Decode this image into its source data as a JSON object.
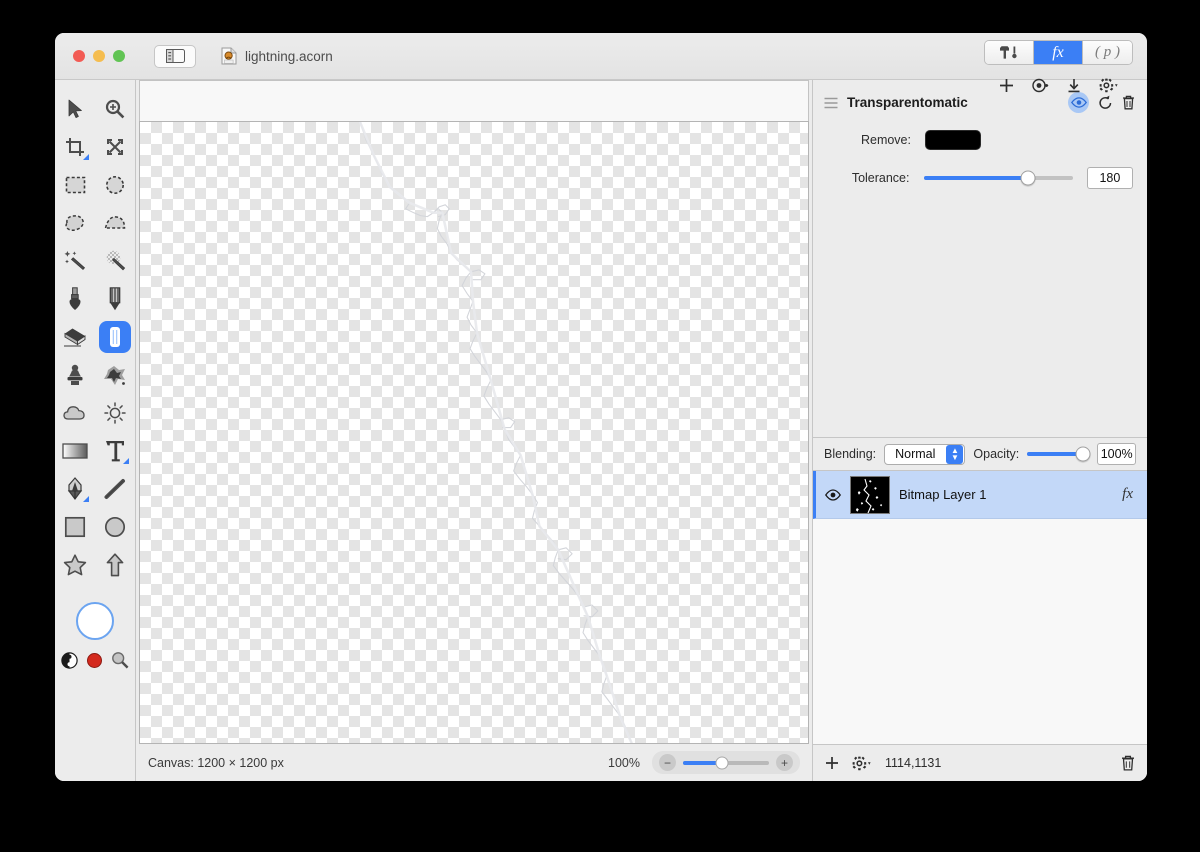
{
  "window": {
    "title": "lightning.acorn",
    "traffic_lights": [
      "close",
      "minimize",
      "zoom"
    ]
  },
  "toolbar": {
    "segments": [
      {
        "id": "tools",
        "label": "",
        "icon": "hammer-tool-icon",
        "active": false
      },
      {
        "id": "filters",
        "label": "fx",
        "icon": "fx-icon",
        "active": true
      },
      {
        "id": "presets",
        "label": "( p )",
        "icon": "palette-icon",
        "active": false
      }
    ],
    "actions": [
      {
        "id": "add",
        "label": "+",
        "icon": "plus-icon"
      },
      {
        "id": "preview",
        "label": "",
        "icon": "preview-eye-icon"
      },
      {
        "id": "save",
        "label": "",
        "icon": "download-icon"
      },
      {
        "id": "settings",
        "label": "",
        "icon": "gear-dropdown-icon"
      }
    ]
  },
  "tools": {
    "rows": [
      [
        {
          "name": "move-tool",
          "selected": false,
          "variant": false
        },
        {
          "name": "zoom-tool",
          "selected": false,
          "variant": false
        }
      ],
      [
        {
          "name": "crop-tool",
          "selected": false,
          "variant": true
        },
        {
          "name": "transform-tool",
          "selected": false,
          "variant": false
        }
      ],
      [
        {
          "name": "rectangle-select-tool",
          "selected": false,
          "variant": false
        },
        {
          "name": "ellipse-select-tool",
          "selected": false,
          "variant": false
        }
      ],
      [
        {
          "name": "lasso-tool",
          "selected": false,
          "variant": false
        },
        {
          "name": "polygon-lasso-tool",
          "selected": false,
          "variant": false
        }
      ],
      [
        {
          "name": "magic-wand-tool",
          "selected": false,
          "variant": false
        },
        {
          "name": "instant-alpha-tool",
          "selected": false,
          "variant": false
        }
      ],
      [
        {
          "name": "ink-bottle-tool",
          "selected": false,
          "variant": false
        },
        {
          "name": "pencil-tool",
          "selected": false,
          "variant": false
        }
      ],
      [
        {
          "name": "eraser-tool",
          "selected": false,
          "variant": false
        },
        {
          "name": "brush-tool",
          "selected": true,
          "variant": false
        }
      ],
      [
        {
          "name": "clone-stamp-tool",
          "selected": false,
          "variant": false
        },
        {
          "name": "smudge-tool",
          "selected": false,
          "variant": false
        }
      ],
      [
        {
          "name": "blur-tool",
          "selected": false,
          "variant": false
        },
        {
          "name": "dodge-tool",
          "selected": false,
          "variant": false
        }
      ],
      [
        {
          "name": "gradient-tool",
          "selected": false,
          "variant": false
        },
        {
          "name": "text-tool",
          "selected": false,
          "variant": true
        }
      ],
      [
        {
          "name": "pen-tool",
          "selected": false,
          "variant": true
        },
        {
          "name": "line-tool",
          "selected": false,
          "variant": false
        }
      ],
      [
        {
          "name": "rectangle-shape-tool",
          "selected": false,
          "variant": false
        },
        {
          "name": "ellipse-shape-tool",
          "selected": false,
          "variant": false
        }
      ],
      [
        {
          "name": "star-shape-tool",
          "selected": false,
          "variant": false
        },
        {
          "name": "arrow-shape-tool",
          "selected": false,
          "variant": false
        }
      ]
    ],
    "colors": {
      "foreground": "#ffffff",
      "accent_swatch": "#d42a1e",
      "ring": "#6ba4f0"
    }
  },
  "filter": {
    "name": "Transparentomatic",
    "enabled": true,
    "remove_label": "Remove:",
    "remove_color": "#000000",
    "tolerance_label": "Tolerance:",
    "tolerance_value": "180",
    "tolerance_percent": 70,
    "header_icons": [
      {
        "name": "drag-handle-icon"
      },
      {
        "name": "visibility-eye-icon"
      },
      {
        "name": "reset-icon"
      },
      {
        "name": "delete-filter-icon"
      }
    ]
  },
  "layers": {
    "blending_label": "Blending:",
    "blending_value": "Normal",
    "opacity_label": "Opacity:",
    "opacity_value": "100%",
    "opacity_percent": 100,
    "items": [
      {
        "name": "Bitmap Layer 1",
        "visible": true,
        "selected": true,
        "has_fx": true
      }
    ],
    "footer": {
      "add_label": "+",
      "coordinates": "1114,1131"
    }
  },
  "status": {
    "canvas_label": "Canvas: 1200 × 1200 px",
    "zoom_label": "100%",
    "zoom_percent": 45
  },
  "canvas": {
    "document_name": "lightning.acorn",
    "transparency_grid": true,
    "content_description": "faint white lightning bolt on transparent background"
  }
}
